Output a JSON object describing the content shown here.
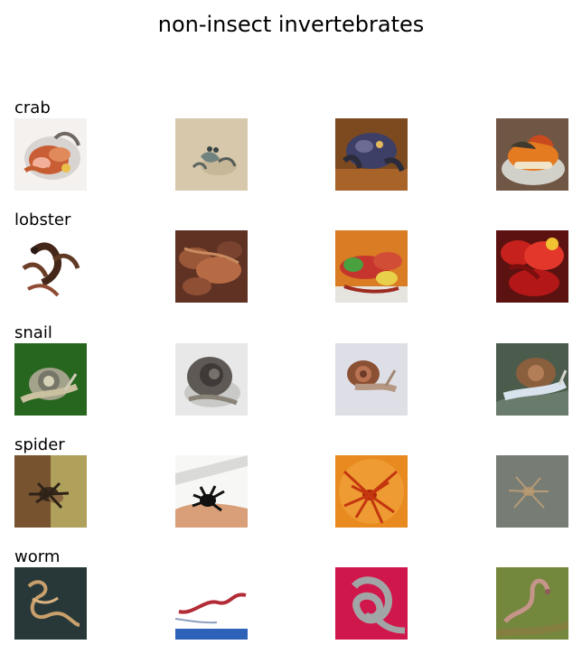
{
  "figure": {
    "title": "non-insect invertebrates"
  },
  "rows": [
    {
      "label": "crab",
      "images": [
        {
          "description": "crab"
        },
        {
          "description": "crab"
        },
        {
          "description": "crab"
        },
        {
          "description": "crab"
        }
      ]
    },
    {
      "label": "lobster",
      "images": [
        {
          "description": "lobster"
        },
        {
          "description": "lobster"
        },
        {
          "description": "lobster"
        },
        {
          "description": "lobster"
        }
      ]
    },
    {
      "label": "snail",
      "images": [
        {
          "description": "snail"
        },
        {
          "description": "snail"
        },
        {
          "description": "snail"
        },
        {
          "description": "snail"
        }
      ]
    },
    {
      "label": "spider",
      "images": [
        {
          "description": "spider"
        },
        {
          "description": "spider"
        },
        {
          "description": "spider"
        },
        {
          "description": "spider"
        }
      ]
    },
    {
      "label": "worm",
      "images": [
        {
          "description": "worm"
        },
        {
          "description": "worm"
        },
        {
          "description": "worm"
        },
        {
          "description": "worm"
        }
      ]
    }
  ]
}
